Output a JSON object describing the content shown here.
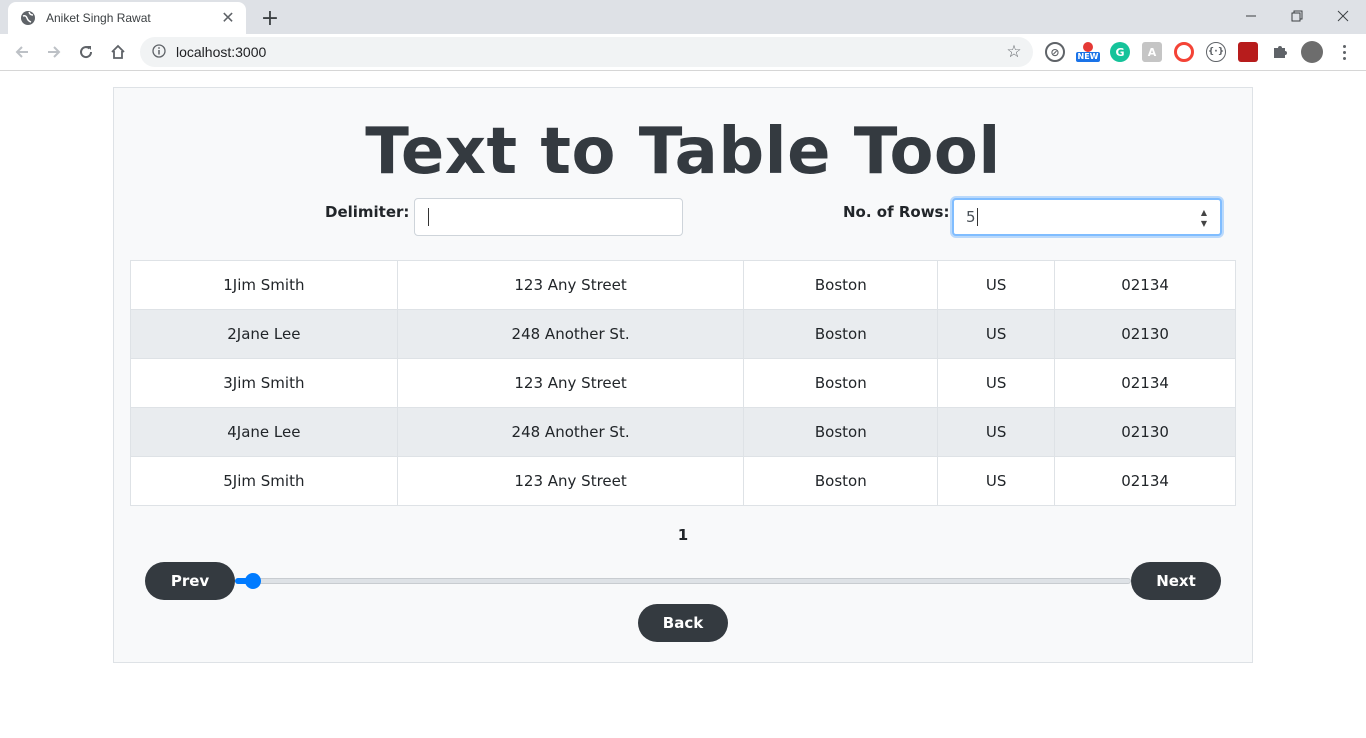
{
  "browser": {
    "tab_title": "Aniket Singh Rawat",
    "url": "localhost:3000",
    "new_ext_badge": "NEW"
  },
  "page": {
    "title": "Text to Table Tool",
    "delimiter_label": "Delimiter:",
    "delimiter_value": "",
    "rows_label": "No. of Rows:",
    "rows_value": "5",
    "table": {
      "rows": [
        [
          "1Jim Smith",
          "123 Any Street",
          "Boston",
          "US",
          "02134"
        ],
        [
          "2Jane Lee",
          "248 Another St.",
          "Boston",
          "US",
          "02130"
        ],
        [
          "3Jim Smith",
          "123 Any Street",
          "Boston",
          "US",
          "02134"
        ],
        [
          "4Jane Lee",
          "248 Another St.",
          "Boston",
          "US",
          "02130"
        ],
        [
          "5Jim Smith",
          "123 Any Street",
          "Boston",
          "US",
          "02134"
        ]
      ]
    },
    "page_number": "1",
    "prev_label": "Prev",
    "next_label": "Next",
    "back_label": "Back",
    "slider_fraction": 0.02
  },
  "colors": {
    "accent": "#007bff",
    "dark_button": "#343a40"
  }
}
